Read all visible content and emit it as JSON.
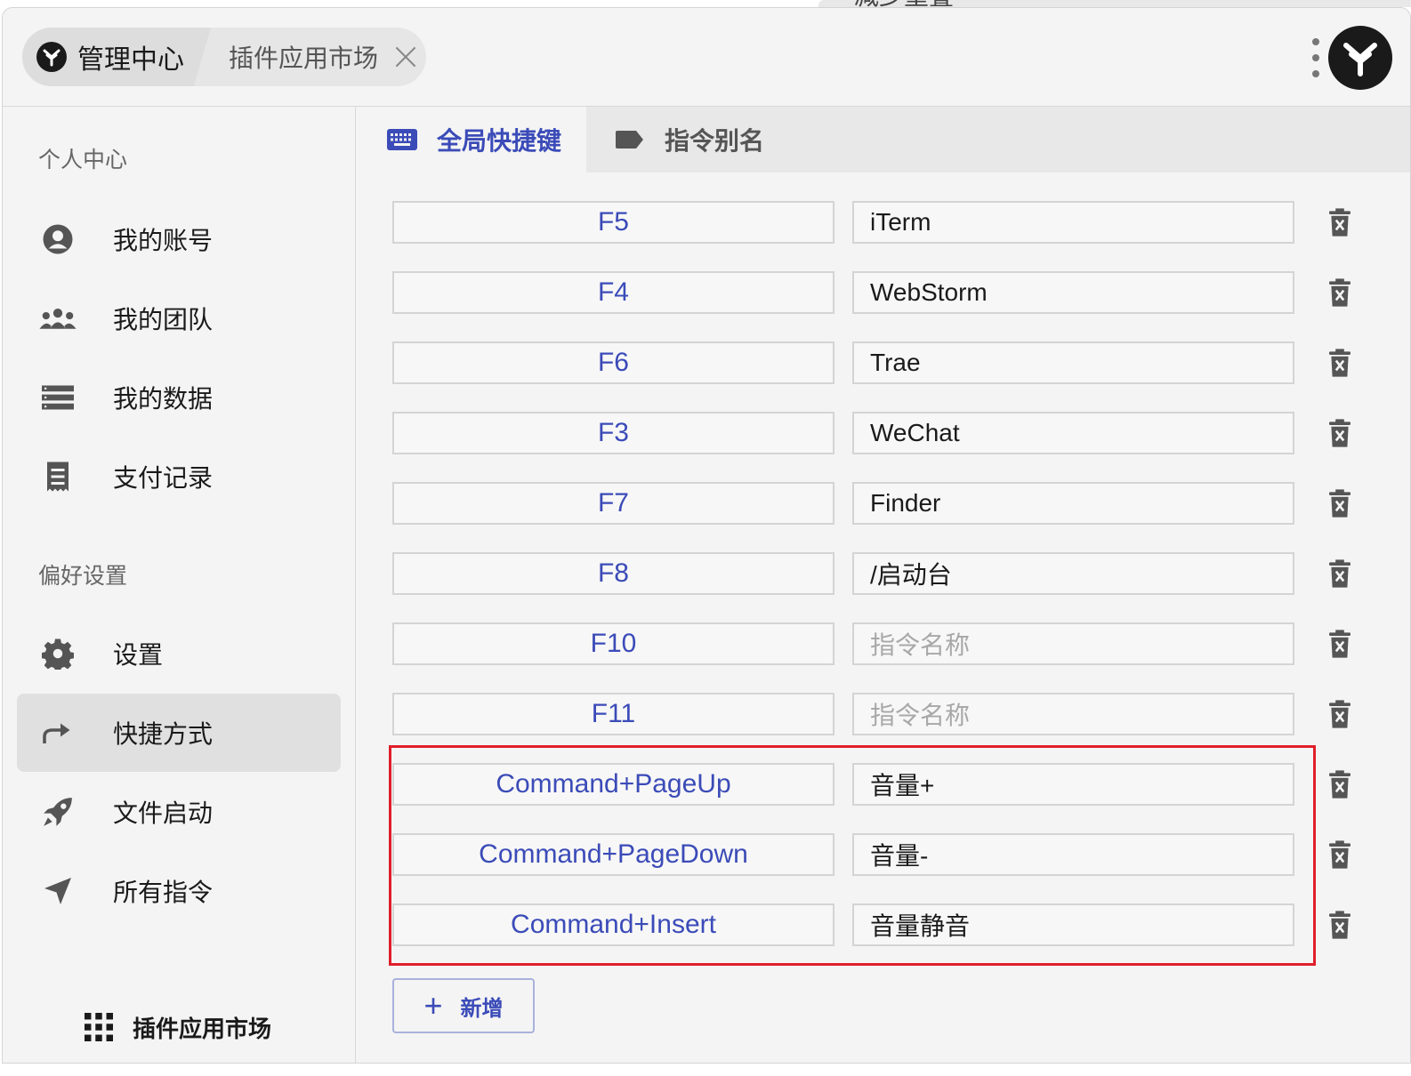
{
  "colors": {
    "accent": "#3b4bb8",
    "highlight": "#e01e2a",
    "text": "#1a1a1a",
    "muted": "#666666"
  },
  "titlebar": {
    "peek_text": "减少重叠",
    "tab_main": "管理中心",
    "tab_second": "插件应用市场"
  },
  "sidebar": {
    "section_personal": "个人中心",
    "personal_items": [
      {
        "label": "我的账号",
        "icon": "account-circle-icon"
      },
      {
        "label": "我的团队",
        "icon": "team-icon"
      },
      {
        "label": "我的数据",
        "icon": "data-list-icon"
      },
      {
        "label": "支付记录",
        "icon": "receipt-icon"
      }
    ],
    "section_prefs": "偏好设置",
    "pref_items": [
      {
        "label": "设置",
        "icon": "gear-icon"
      },
      {
        "label": "快捷方式",
        "icon": "share-arrow-icon",
        "active": true
      },
      {
        "label": "文件启动",
        "icon": "rocket-icon"
      },
      {
        "label": "所有指令",
        "icon": "send-icon"
      }
    ],
    "market_link": "插件应用市场"
  },
  "main": {
    "tab_hotkeys": "全局快捷键",
    "tab_alias": "指令别名",
    "placeholder": "指令名称",
    "rows": [
      {
        "key": "F5",
        "command": "iTerm"
      },
      {
        "key": "F4",
        "command": "WebStorm"
      },
      {
        "key": "F6",
        "command": "Trae"
      },
      {
        "key": "F3",
        "command": "WeChat"
      },
      {
        "key": "F7",
        "command": "Finder"
      },
      {
        "key": "F8",
        "command": "/启动台"
      },
      {
        "key": "F10",
        "command": ""
      },
      {
        "key": "F11",
        "command": ""
      },
      {
        "key": "Command+PageUp",
        "command": "音量+"
      },
      {
        "key": "Command+PageDown",
        "command": "音量-"
      },
      {
        "key": "Command+Insert",
        "command": "音量静音"
      }
    ],
    "add_label": "新增"
  }
}
